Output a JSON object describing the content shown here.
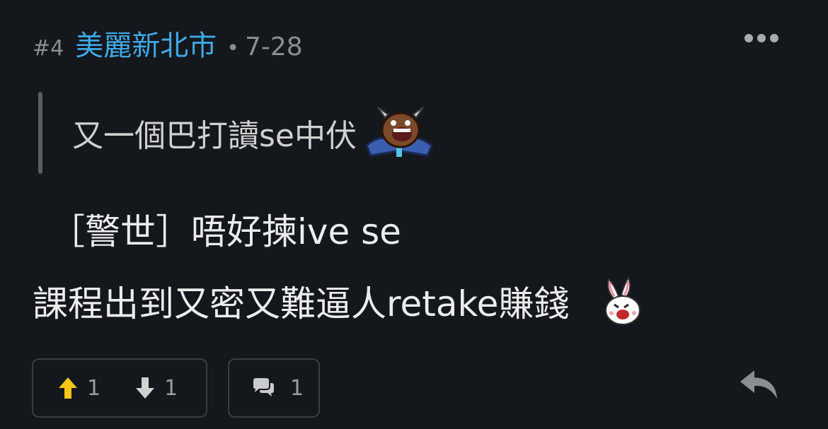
{
  "post": {
    "floor": "#4",
    "author": "美麗新北市",
    "separator": "•",
    "time": "7-28"
  },
  "quote": {
    "text": "又一個巴打讀se中伏",
    "emoji": "bull-crying-emoji"
  },
  "content": {
    "line1": "［警世］唔好揀ive se",
    "line2": "課程出到又密又難逼人retake賺錢",
    "emoji": "rabbit-laughing-emoji"
  },
  "actions": {
    "upvote_count": "1",
    "downvote_count": "1",
    "reply_count": "1"
  },
  "colors": {
    "background": "#14171c",
    "author": "#3fa9e6",
    "upvote": "#f5c518",
    "muted": "#8a8d92"
  }
}
